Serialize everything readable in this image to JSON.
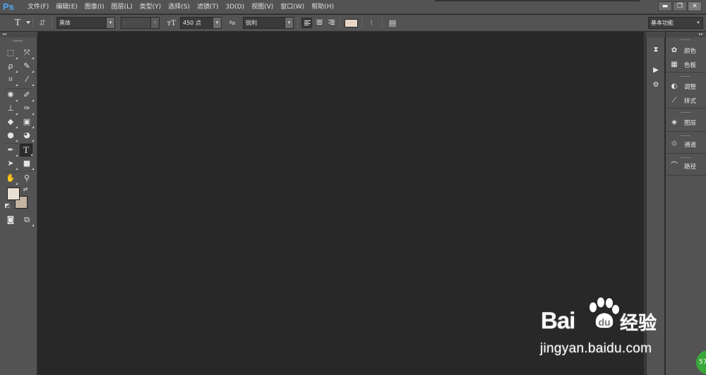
{
  "app": {
    "logo": "Ps"
  },
  "menu": {
    "items": [
      "文件(F)",
      "编辑(E)",
      "图像(I)",
      "图层(L)",
      "类型(Y)",
      "选择(S)",
      "滤镜(T)",
      "3D(D)",
      "视图(V)",
      "窗口(W)",
      "帮助(H)"
    ]
  },
  "window_controls": {
    "minimize": "▬",
    "restore": "❐",
    "close": "✕"
  },
  "options": {
    "tool_icon": "text-tool-icon",
    "font_family": "黑体",
    "font_style": "-",
    "font_size": "450 点",
    "aa_label": "ªa",
    "antialias": "锐利",
    "text_color": "#e6d5c5",
    "workspace": "基本功能"
  },
  "toolbox": {
    "foreground_color": "#e9dfd3",
    "background_color": "#c3b3a1"
  },
  "panels": {
    "dock": [
      {
        "icon": "color-icon",
        "label": "颜色"
      },
      {
        "icon": "swatches-icon",
        "label": "色板"
      },
      {
        "icon": "adjustments-icon",
        "label": "调整"
      },
      {
        "icon": "styles-icon",
        "label": "样式"
      },
      {
        "icon": "layers-icon",
        "label": "图层"
      },
      {
        "icon": "channels-icon",
        "label": "通道"
      },
      {
        "icon": "paths-icon",
        "label": "路径"
      }
    ]
  },
  "watermark": {
    "brand_text": "Bai",
    "brand_cn": "经验",
    "url": "jingyan.baidu.com",
    "badge": "57"
  }
}
